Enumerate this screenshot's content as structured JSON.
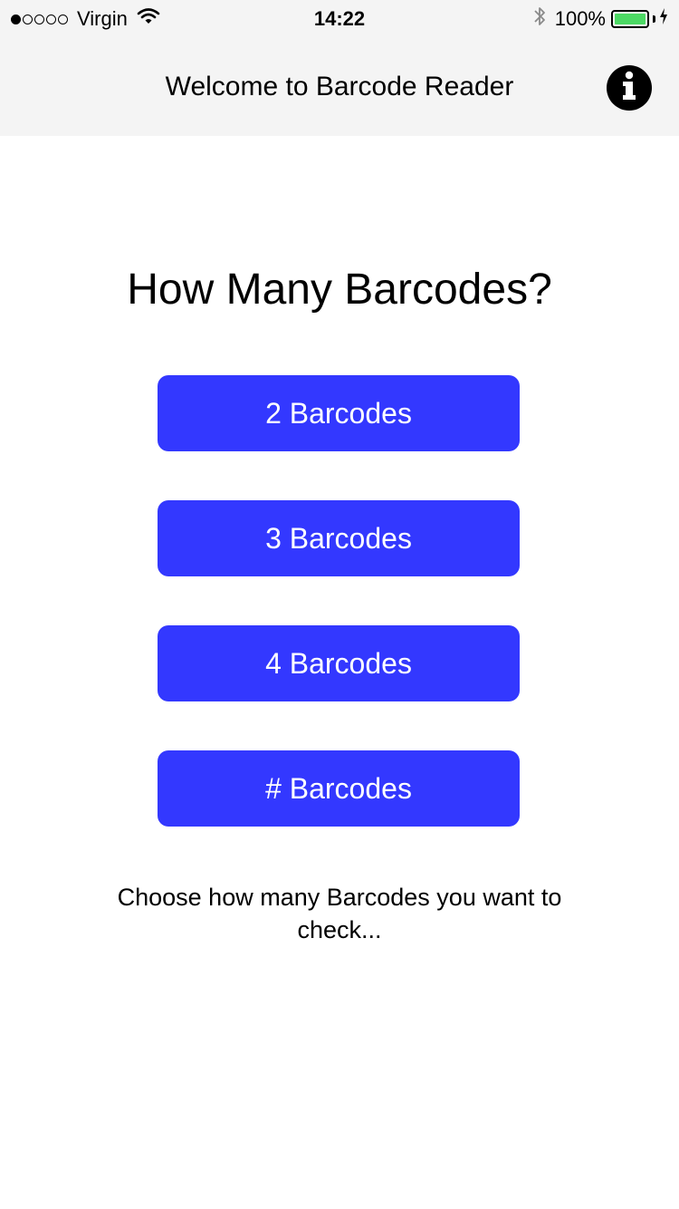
{
  "status_bar": {
    "signal_bars_filled": 1,
    "signal_bars_total": 5,
    "carrier": "Virgin",
    "wifi_icon": "wifi-icon",
    "time": "14:22",
    "bluetooth_icon": "bluetooth-icon",
    "battery_percent": "100%",
    "battery_level": 1.0,
    "charging_icon": "charging-bolt-icon",
    "battery_color": "#4cd964"
  },
  "navbar": {
    "title": "Welcome to Barcode Reader",
    "info_icon": "info-icon",
    "background": "#f4f4f4"
  },
  "main": {
    "heading": "How Many Barcodes?",
    "button_color": "#3338ff",
    "options": [
      {
        "label": "2 Barcodes"
      },
      {
        "label": "3 Barcodes"
      },
      {
        "label": "4 Barcodes"
      },
      {
        "label": "# Barcodes"
      }
    ],
    "hint": "Choose how many Barcodes you want to check..."
  }
}
